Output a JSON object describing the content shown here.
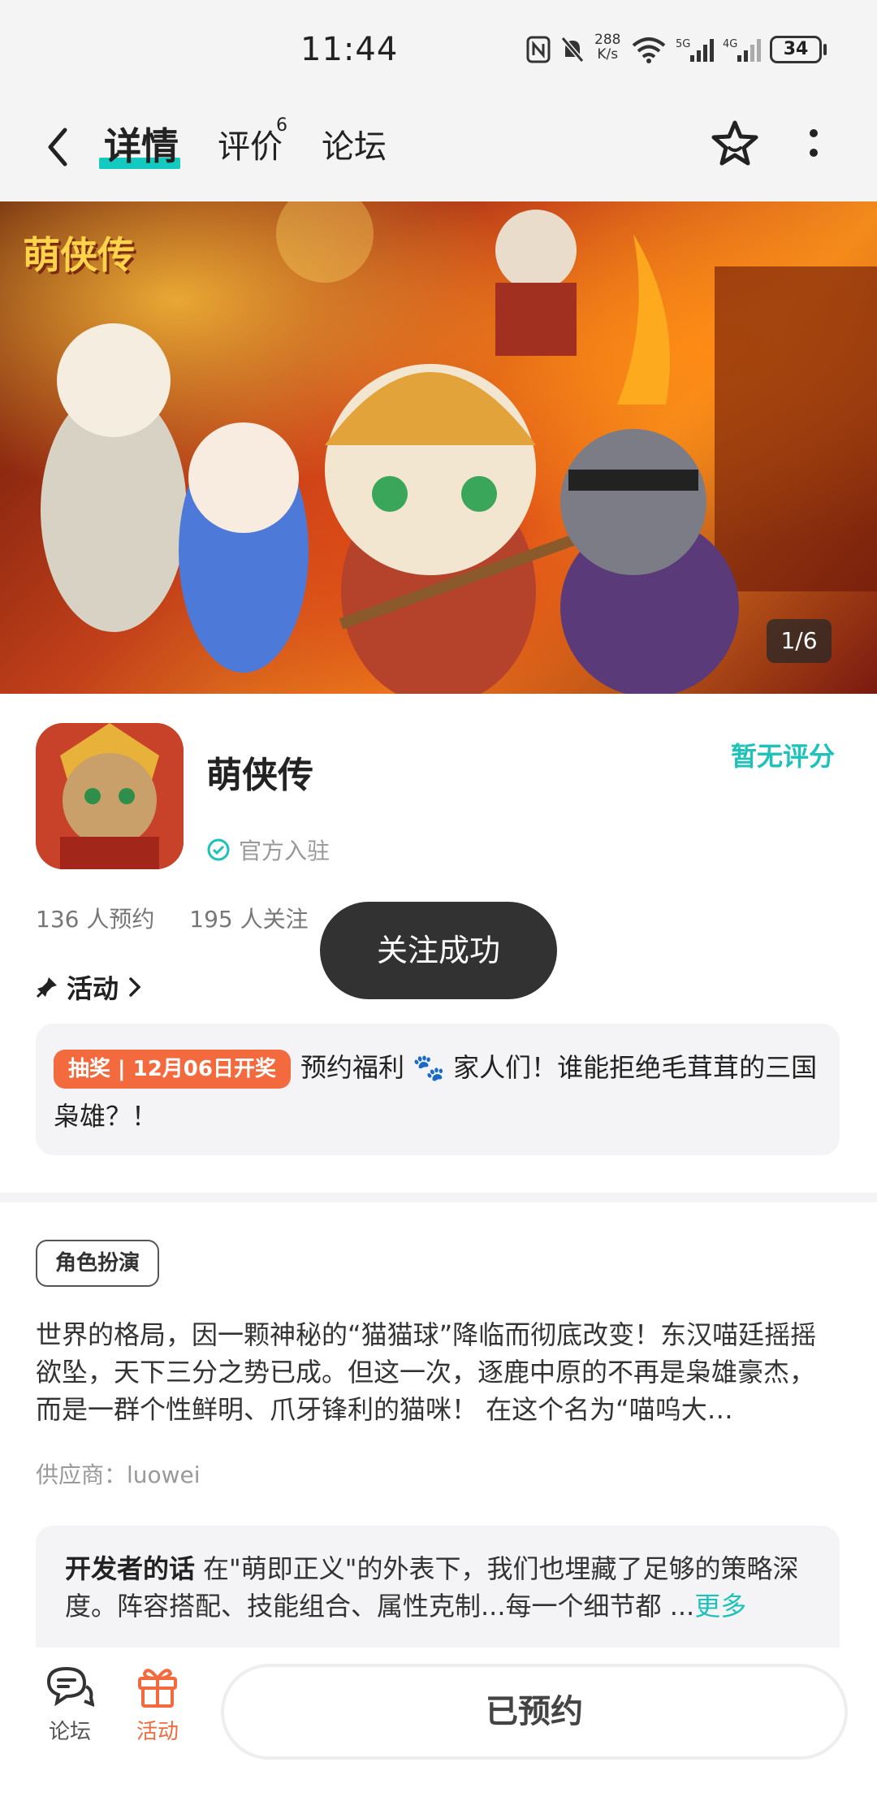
{
  "status_bar": {
    "time": "11:44",
    "net_speed": "288\nK/s",
    "battery": "34",
    "icons": [
      "nfc-icon",
      "mute-icon",
      "wifi-icon",
      "5g-signal-icon",
      "4g-signal-icon",
      "battery-icon"
    ]
  },
  "nav": {
    "tabs": [
      {
        "label": "详情"
      },
      {
        "label": "评价",
        "count": "6"
      },
      {
        "label": "论坛"
      }
    ],
    "icons": [
      "back-icon",
      "star-favorite-icon",
      "more-icon"
    ]
  },
  "banner": {
    "logo_text": "萌侠传",
    "counter": "1/6"
  },
  "app": {
    "name": "萌侠传",
    "official": "官方入驻",
    "rating": "暂无评分",
    "reservations": "136 人预约",
    "followers": "195 人关注"
  },
  "toast": "关注成功",
  "activity": {
    "title": "活动",
    "badge": "抽奖 | 12月06日开奖",
    "text": "预约福利 🐾 家人们！谁能拒绝毛茸茸的三国枭雄？！"
  },
  "genre_tag": "角色扮演",
  "description": "世界的格局，因一颗神秘的“猫猫球”降临而彻底改变！东汉喵廷摇摇欲坠，天下三分之势已成。但这一次，逐鹿中原的不再是枭雄豪杰，而是一群个性鲜明、爪牙锋利的猫咪！ 在这个名为“喵呜大…",
  "supplier": "供应商：luowei",
  "developer": {
    "label": "开发者的话",
    "text": "在\"萌即正义\"的外表下，我们也埋藏了足够的策略深度。阵容搭配、技能组合、属性克制...每一个细节都 ...",
    "more": "更多"
  },
  "bottom_bar": {
    "forum": "论坛",
    "activity": "活动",
    "reserve_button": "已预约"
  },
  "colors": {
    "accent": "#1ec2b8",
    "orange": "#f26a3d",
    "toast_bg": "#323232"
  }
}
